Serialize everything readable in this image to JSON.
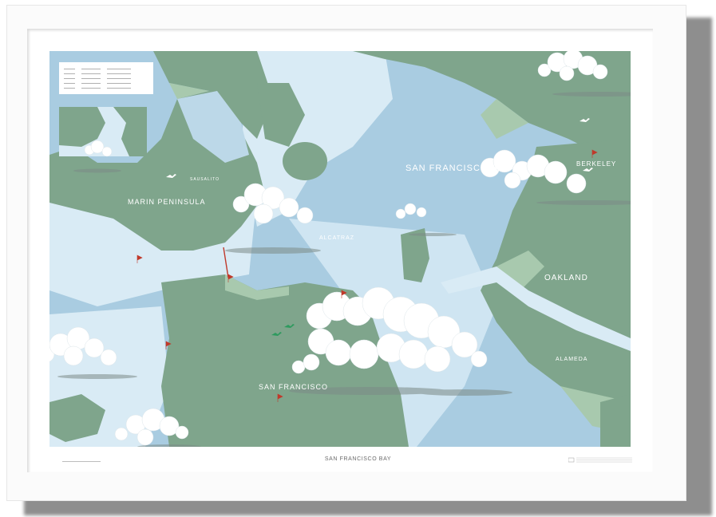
{
  "map": {
    "title": "SAN FRANCISCO BAY",
    "labels": {
      "bay": "SAN FRANCISCO BAY",
      "marin": "MARIN PENINSULA",
      "sf": "SAN FRANCISCO",
      "oakland": "OAKLAND",
      "berkeley": "BERKELEY",
      "alameda": "ALAMEDA",
      "alcatraz": "ALCATRAZ",
      "sausalito": "SAUSALITO"
    },
    "colors": {
      "land": "#7fa58c",
      "water_deep": "#a9cce1",
      "water_shallow": "#d9ebf5",
      "land_light": "#a8c9ae",
      "frame": "#fbfbfb",
      "shadow": "#8e8e8e",
      "flag": "#c0392b"
    }
  }
}
